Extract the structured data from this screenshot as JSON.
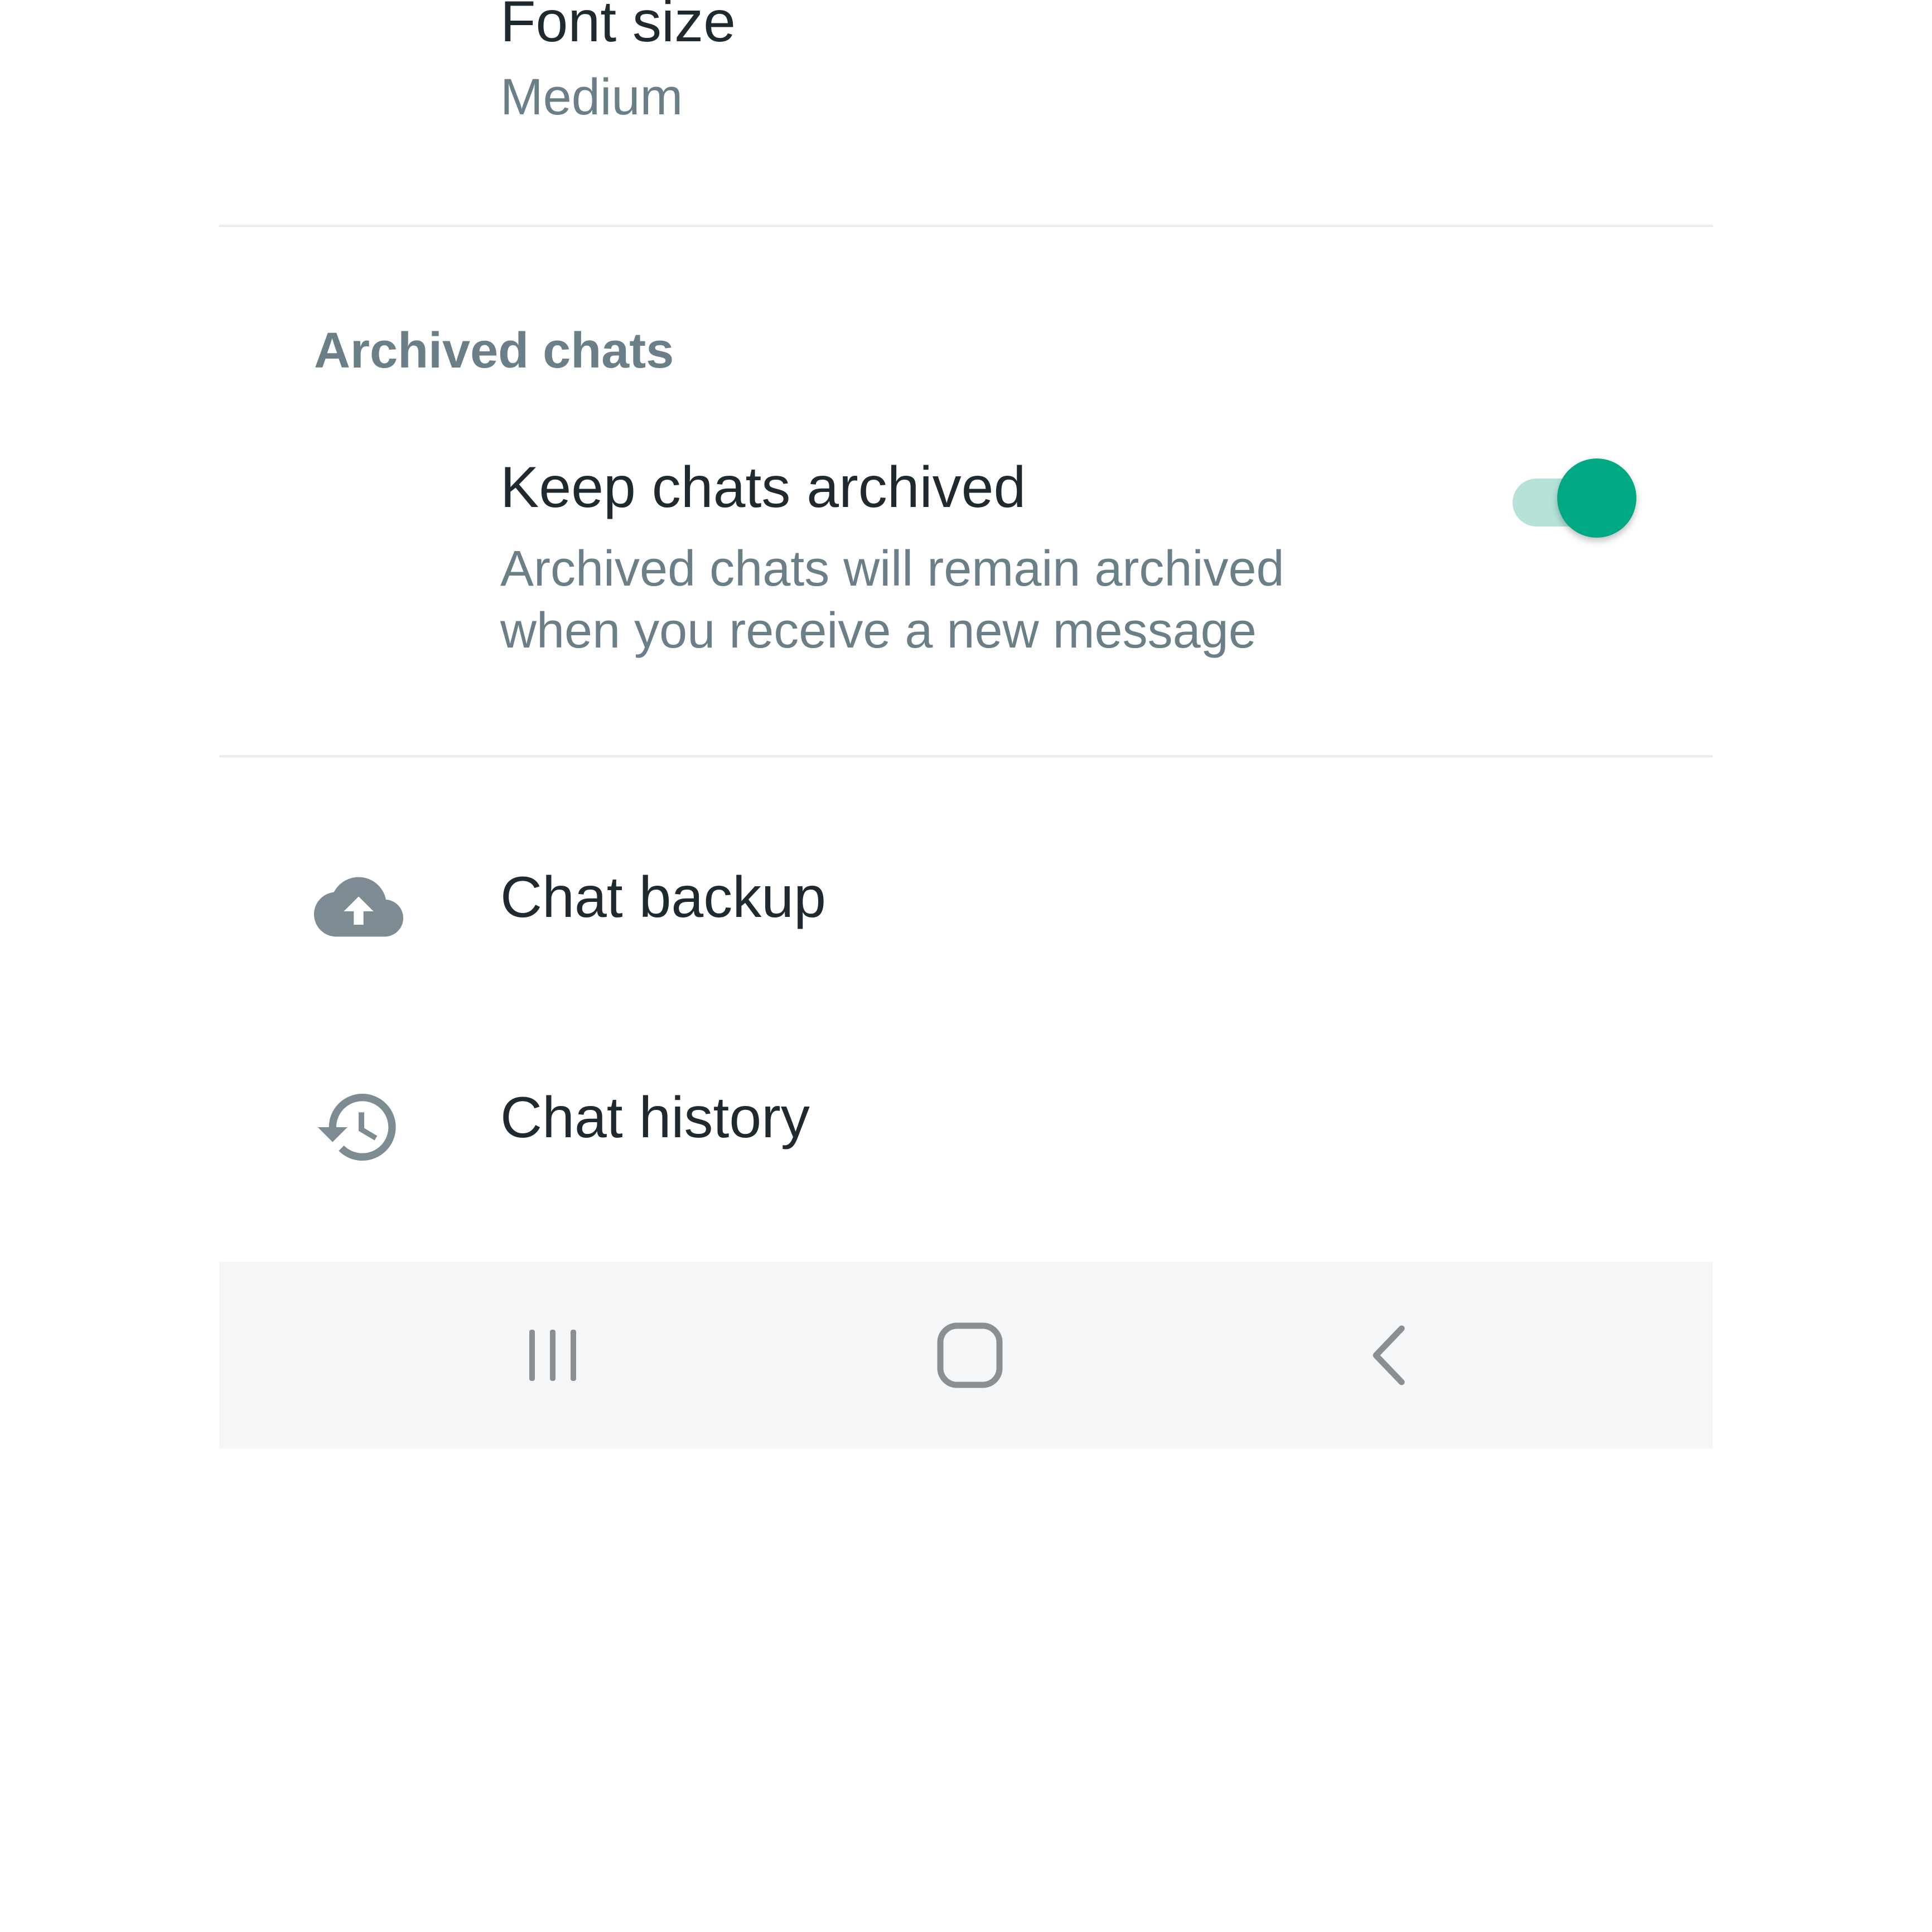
{
  "settings": {
    "font_size": {
      "title": "Font size",
      "value": "Medium"
    },
    "archived_section": {
      "header": "Archived chats",
      "keep_archived": {
        "title": "Keep chats archived",
        "description": "Archived chats will remain archived when you receive a new message",
        "enabled": true
      }
    },
    "items": [
      {
        "label": "Chat backup",
        "icon": "cloud-upload-icon"
      },
      {
        "label": "Chat history",
        "icon": "history-icon"
      }
    ]
  },
  "navbar": {
    "buttons": [
      "recents-icon",
      "home-icon",
      "back-icon"
    ]
  },
  "colors": {
    "accent": "#00a884",
    "accent_light": "#b5e3d9",
    "primary_text": "#1f2a30",
    "secondary_text": "#6b7f89",
    "icon": "#7d8b93",
    "navbar_bg": "#f5f6f8"
  }
}
